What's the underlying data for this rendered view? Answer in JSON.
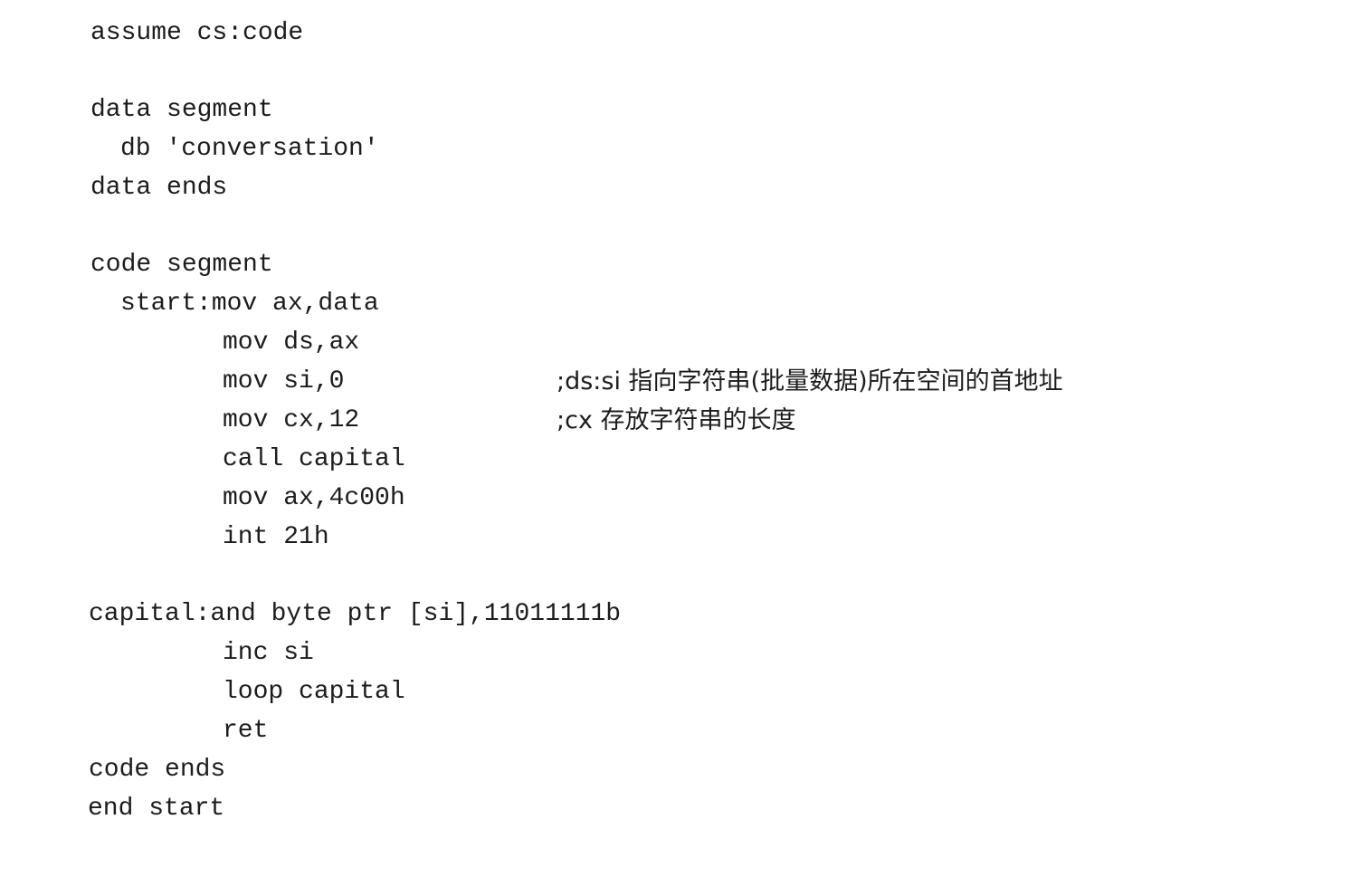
{
  "listing": {
    "l01": "assume cs:code",
    "l02": "data segment",
    "l03": "db 'conversation'",
    "l04": "data ends",
    "l05": "code segment",
    "l06": "start:mov ax,data",
    "l07": "mov ds,ax",
    "l08": "mov si,0",
    "l08_comment": ";ds:si 指向字符串(批量数据)所在空间的首地址",
    "l09": "mov cx,12",
    "l09_comment": ";cx 存放字符串的长度",
    "l10": "call capital",
    "l11": "mov ax,4c00h",
    "l12": "int 21h",
    "l13": "capital:and byte ptr [si],11011111b",
    "l14": "inc si",
    "l15": "loop capital",
    "l16": "ret",
    "l17": "code ends",
    "l18": "end start"
  }
}
